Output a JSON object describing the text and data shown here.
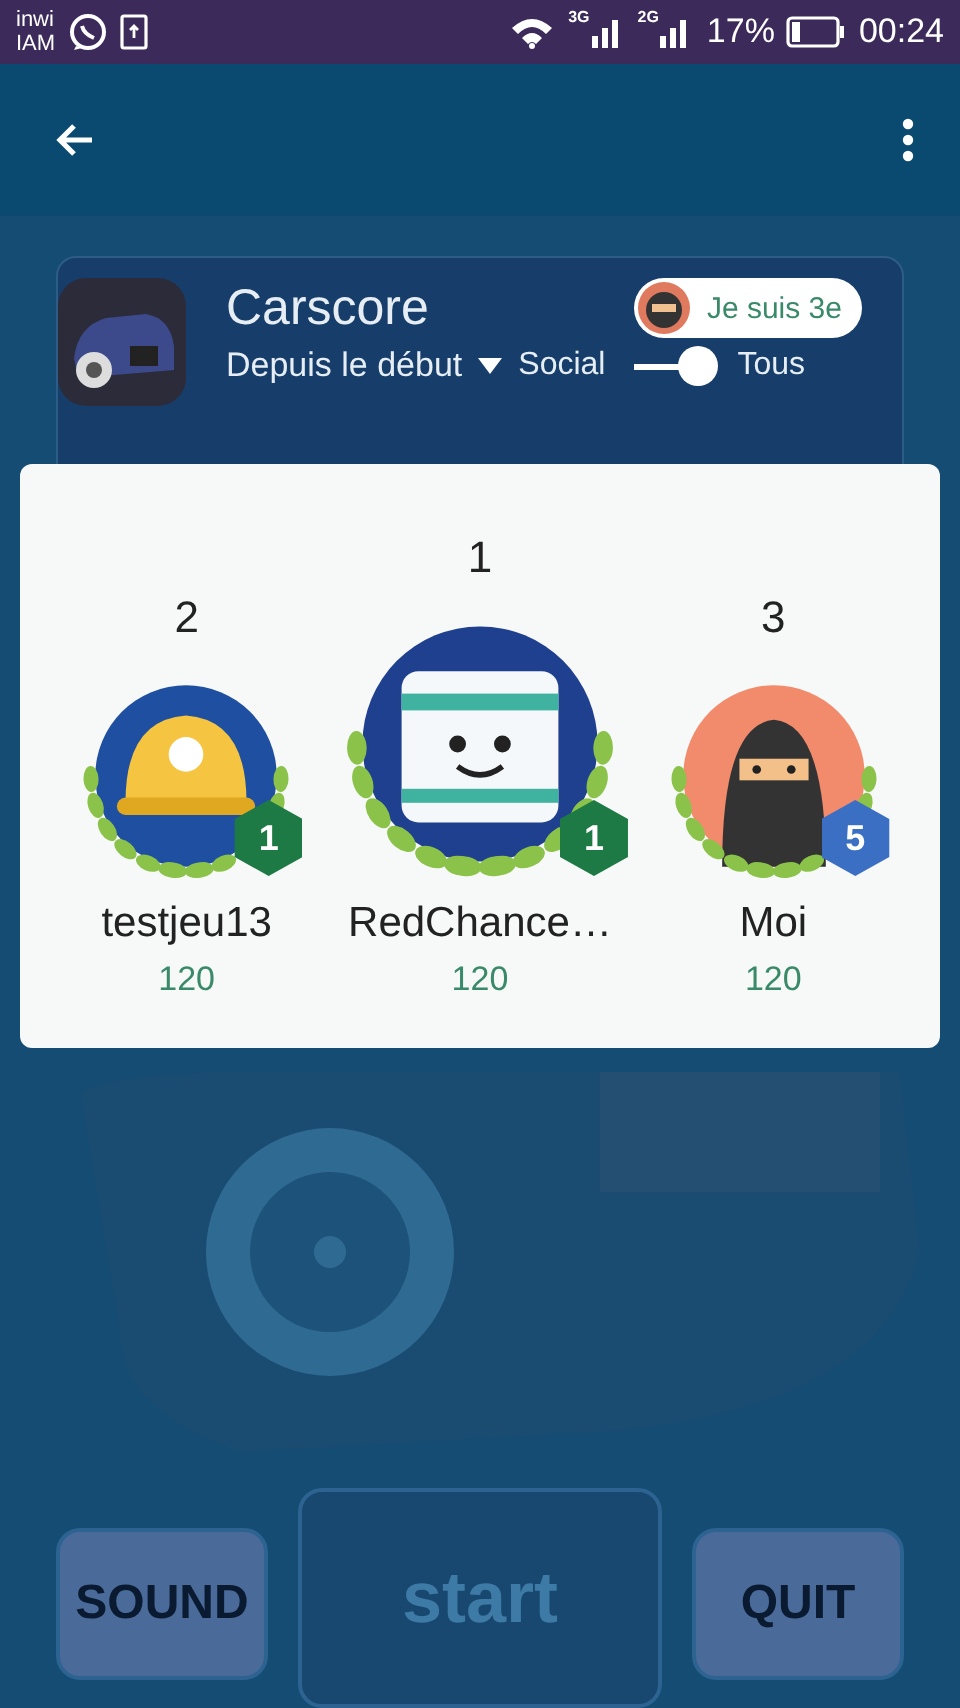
{
  "status_bar": {
    "carrier_top": "inwi",
    "carrier_bottom": "IAM",
    "network_1": "3G",
    "network_2": "2G",
    "battery": "17%",
    "time": "00:24"
  },
  "background": {
    "buttons": [
      {
        "label": "SOUND",
        "kind": "side"
      },
      {
        "label": "start",
        "kind": "main"
      },
      {
        "label": "QUIT",
        "kind": "side"
      }
    ]
  },
  "leaderboard": {
    "title": "Carscore",
    "my_rank": "Je suis 3e",
    "period": "Depuis le début",
    "filter_left": "Social",
    "filter_right": "Tous",
    "toggle": {
      "on": true
    },
    "podium": [
      {
        "rank": "2",
        "name": "testjeu13",
        "score": "120",
        "level": "1",
        "color": "#1e7a45",
        "kind": "cap"
      },
      {
        "rank": "1",
        "name": "RedChance…",
        "score": "120",
        "level": "1",
        "color": "#1e7a45",
        "kind": "robot"
      },
      {
        "rank": "3",
        "name": "Moi",
        "score": "120",
        "level": "5",
        "color": "#3b6fc4",
        "kind": "ninja"
      }
    ]
  }
}
